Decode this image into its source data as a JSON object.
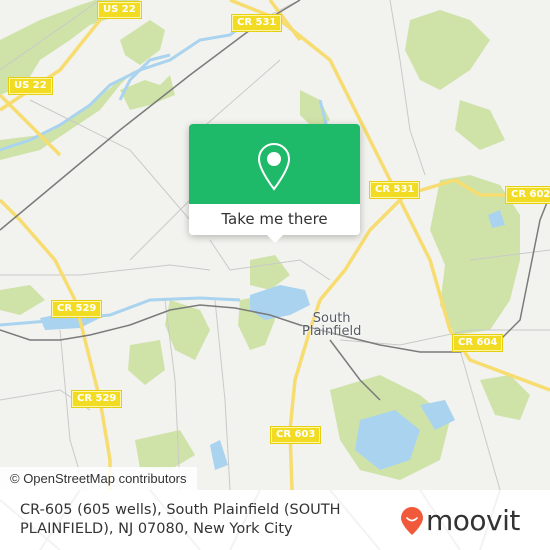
{
  "map": {
    "road_shields": [
      {
        "id": "us22-top",
        "label": "US 22"
      },
      {
        "id": "us22-left",
        "label": "US 22"
      },
      {
        "id": "cr531-top",
        "label": "CR 531"
      },
      {
        "id": "cr531-mid",
        "label": "CR 531"
      },
      {
        "id": "cr602",
        "label": "CR 602"
      },
      {
        "id": "cr529-upper",
        "label": "CR 529"
      },
      {
        "id": "cr529-lower",
        "label": "CR 529"
      },
      {
        "id": "cr604",
        "label": "CR 604"
      },
      {
        "id": "cr603",
        "label": "CR 603"
      }
    ],
    "place_labels": [
      {
        "id": "south-plainfield",
        "line1": "South",
        "line2": "Plainfield"
      }
    ],
    "attribution": "© OpenStreetMap contributors",
    "colors": {
      "background": "#f2f2ee",
      "park": "#cfe3a8",
      "water": "#a9d3ee",
      "major_road": "#f7dc6f",
      "minor_road": "#c9c9c9",
      "rail": "#7b7b7b"
    }
  },
  "popup": {
    "icon": "map-pin-icon",
    "button_label": "Take me there",
    "accent_color": "#1fb96a"
  },
  "footer": {
    "address": "CR-605 (605 wells), South Plainfield (SOUTH PLAINFIELD), NJ 07080, New York City",
    "brand": "moovit",
    "brand_color": "#f05a3a"
  }
}
